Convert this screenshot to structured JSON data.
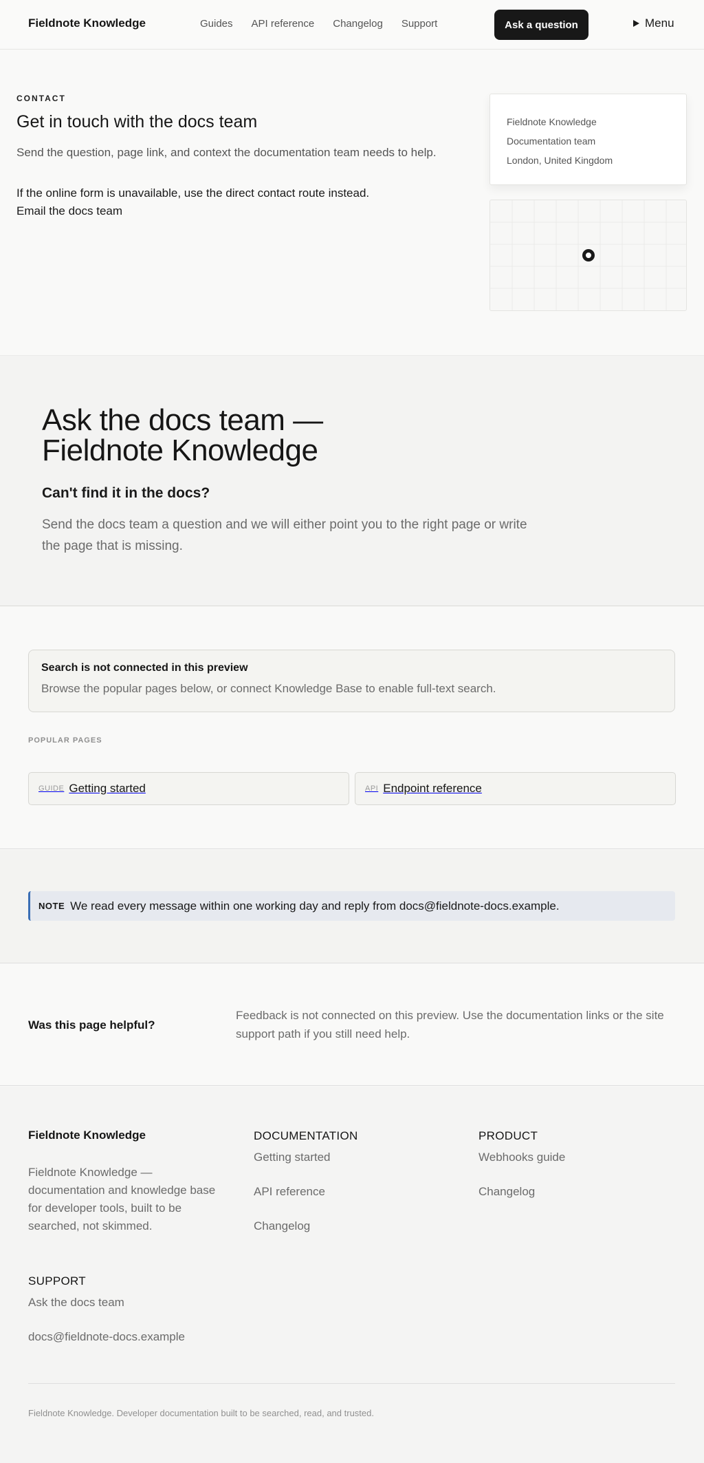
{
  "header": {
    "brand": "Fieldnote Knowledge",
    "nav": [
      "Guides",
      "API reference",
      "Changelog",
      "Support"
    ],
    "cta_label": "Ask a question",
    "menu_label": "Menu"
  },
  "contact": {
    "eyebrow": "CONTACT",
    "title": "Get in touch with the docs team",
    "subtitle": "Send the question, page link, and context the documentation team needs to help.",
    "fallback_text": "If the online form is unavailable, use the direct contact route instead.",
    "email_link_label": "Email the docs team",
    "address_lines": [
      "Fieldnote Knowledge",
      "Documentation team",
      "London, United Kingdom"
    ]
  },
  "hero": {
    "title_line_1": "Ask the docs team —",
    "title_line_2": "Fieldnote Knowledge",
    "heading": "Can't find it in the docs?",
    "body": "Send the docs team a question and we will either point you to the right page or write the page that is missing."
  },
  "search": {
    "notice_title": "Search is not connected in this preview",
    "notice_body": "Browse the popular pages below, or connect Knowledge Base to enable full-text search.",
    "popular_label": "POPULAR PAGES",
    "popular_pages": [
      {
        "tag": "GUIDE",
        "name": "Getting started"
      },
      {
        "tag": "API",
        "name": "Endpoint reference"
      }
    ]
  },
  "note": {
    "label": "NOTE",
    "text": "We read every message within one working day and reply from docs@fieldnote-docs.example."
  },
  "feedback": {
    "question": "Was this page helpful?",
    "text": "Feedback is not connected on this preview. Use the documentation links or the site support path if you still need help."
  },
  "footer": {
    "brand": "Fieldnote Knowledge",
    "description": "Fieldnote Knowledge — documentation and knowledge base for developer tools, built to be searched, not skimmed.",
    "documentation": {
      "heading": "DOCUMENTATION",
      "links": [
        "Getting started",
        "API reference",
        "Changelog"
      ]
    },
    "product": {
      "heading": "PRODUCT",
      "links": [
        "Webhooks guide",
        "Changelog"
      ]
    },
    "support": {
      "heading": "SUPPORT",
      "links": [
        "Ask the docs team",
        "docs@fieldnote-docs.example"
      ]
    },
    "copyright": "Fieldnote Knowledge. Developer documentation built to be searched, read, and trusted."
  },
  "colors": {
    "accent_note": "#3a6eb5",
    "button_dark": "#181818",
    "page_bg": "#f9f9f8"
  },
  "icons": {
    "menu": "triangle-right-icon",
    "map_pin": "map-pin-icon"
  }
}
